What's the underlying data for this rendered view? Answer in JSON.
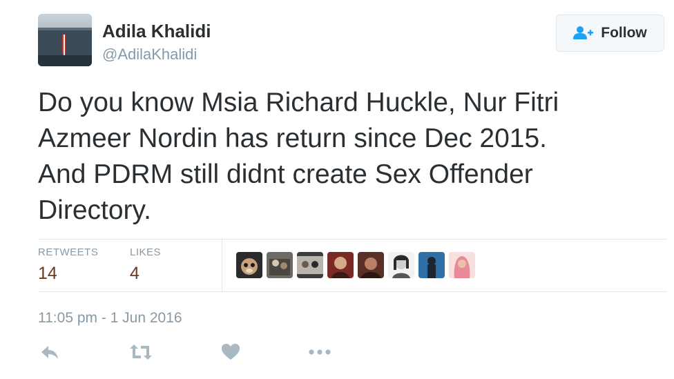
{
  "author": {
    "name": "Adila Khalidi",
    "handle": "@AdilaKhalidi",
    "avatar_icon": "avatar-photo-icon"
  },
  "follow_button": {
    "label": "Follow",
    "icon": "add-user-icon"
  },
  "tweet": {
    "lines": [
      "Do you know Msia Richard Huckle, Nur Fitri",
      "Azmeer Nordin has return since Dec 2015.",
      "And PDRM still didnt create Sex Offender",
      "Directory."
    ]
  },
  "stats": {
    "retweets_label": "RETWEETS",
    "retweets_value": "14",
    "likes_label": "LIKES",
    "likes_value": "4"
  },
  "likers": [
    "liker-avatar-1",
    "liker-avatar-2",
    "liker-avatar-3",
    "liker-avatar-4",
    "liker-avatar-5",
    "liker-avatar-6",
    "liker-avatar-7",
    "liker-avatar-8"
  ],
  "timestamp": "11:05 pm - 1 Jun 2016",
  "actions": [
    "reply-icon",
    "retweet-icon",
    "like-icon",
    "more-icon"
  ],
  "colors": {
    "text": "#292f33",
    "secondary": "#8899a6",
    "stat_value": "#6b3a1e",
    "follow_icon": "#1da1f2",
    "action_icon": "#aab8c2"
  }
}
